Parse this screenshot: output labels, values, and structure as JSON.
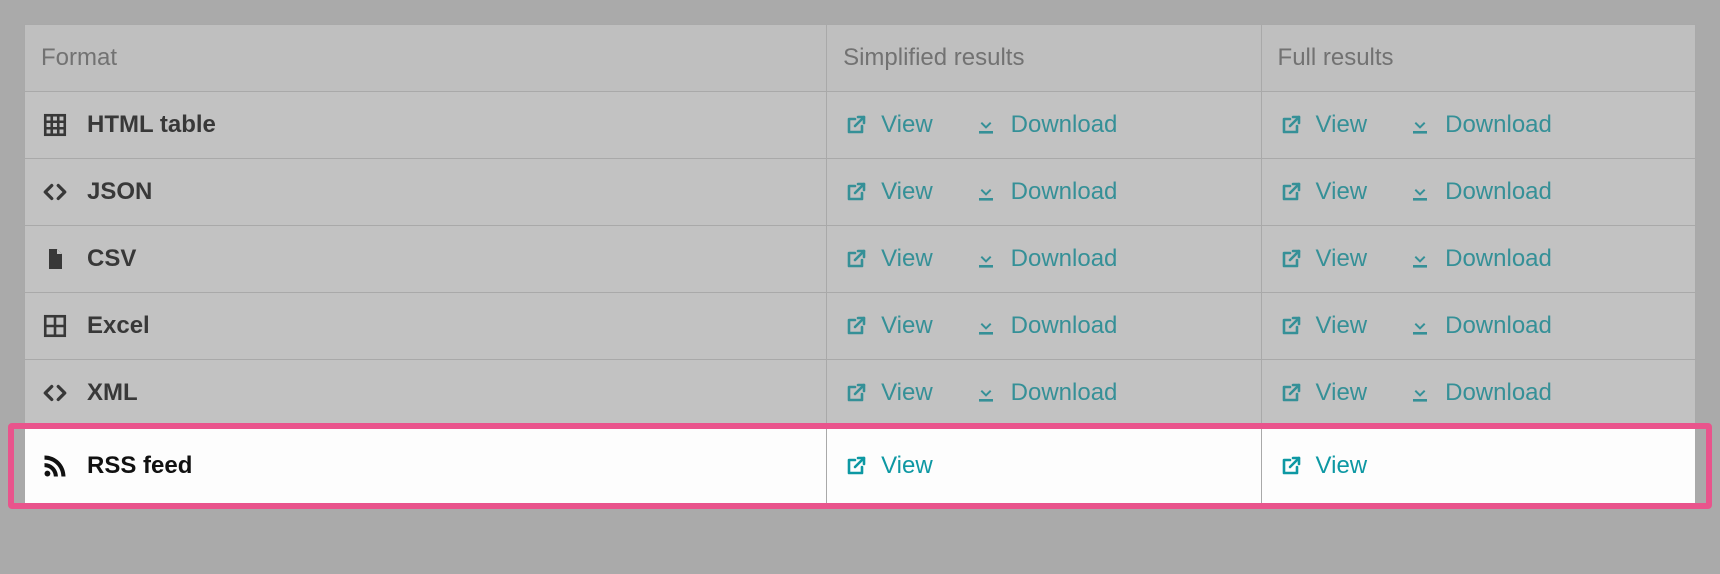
{
  "colors": {
    "link": "#0d98a3",
    "highlight_border": "#e9548c"
  },
  "headers": {
    "format": "Format",
    "simplified": "Simplified results",
    "full": "Full results"
  },
  "action_labels": {
    "view": "View",
    "download": "Download"
  },
  "rows": [
    {
      "icon": "grid",
      "label": "HTML table",
      "simplified": {
        "view": true,
        "download": true
      },
      "full": {
        "view": true,
        "download": true
      },
      "highlighted": false
    },
    {
      "icon": "code",
      "label": "JSON",
      "simplified": {
        "view": true,
        "download": true
      },
      "full": {
        "view": true,
        "download": true
      },
      "highlighted": false
    },
    {
      "icon": "file",
      "label": "CSV",
      "simplified": {
        "view": true,
        "download": true
      },
      "full": {
        "view": true,
        "download": true
      },
      "highlighted": false
    },
    {
      "icon": "excel",
      "label": "Excel",
      "simplified": {
        "view": true,
        "download": true
      },
      "full": {
        "view": true,
        "download": true
      },
      "highlighted": false
    },
    {
      "icon": "code",
      "label": "XML",
      "simplified": {
        "view": true,
        "download": true
      },
      "full": {
        "view": true,
        "download": true
      },
      "highlighted": false
    },
    {
      "icon": "rss",
      "label": "RSS feed",
      "simplified": {
        "view": true,
        "download": false
      },
      "full": {
        "view": true,
        "download": false
      },
      "highlighted": true
    }
  ]
}
